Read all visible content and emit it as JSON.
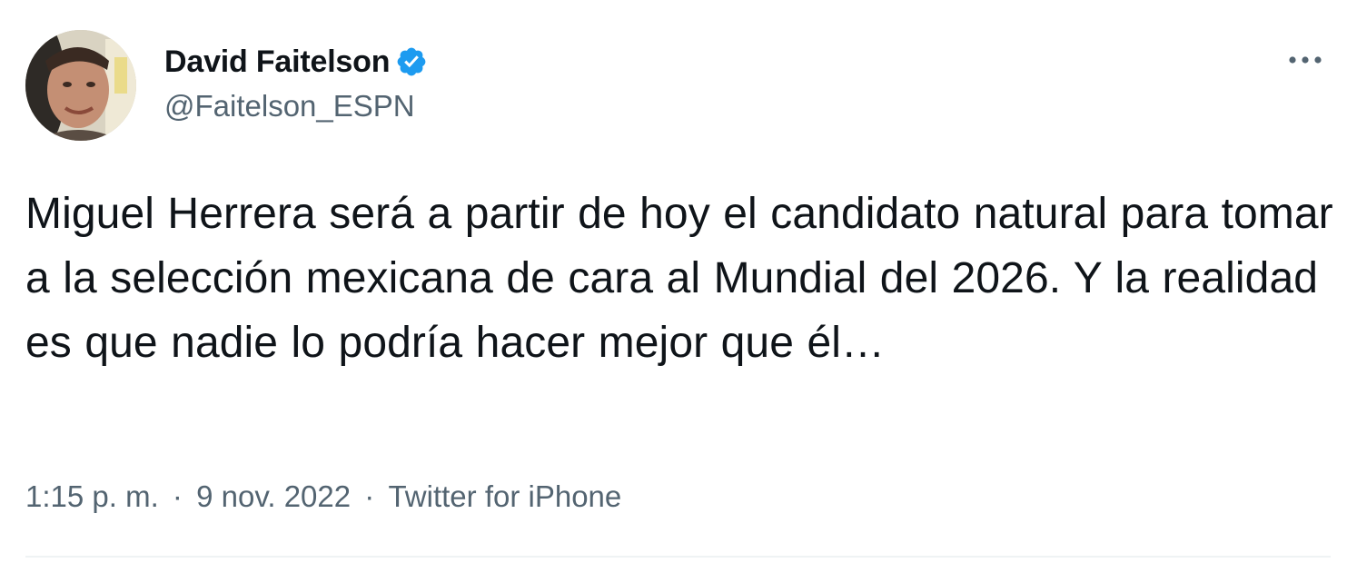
{
  "tweet": {
    "author": {
      "display_name": "David Faitelson",
      "handle": "@Faitelson_ESPN",
      "verified": true,
      "verified_icon": "verified-badge-icon",
      "avatar": "author-avatar"
    },
    "text": "Miguel Herrera será a partir de hoy el candidato natural para tomar a la selección mexicana de cara al Mundial del 2026. Y la realidad es que nadie lo podría hacer mejor que él…",
    "time": "1:15 p. m.",
    "separator": "·",
    "date": "9 nov. 2022",
    "source": "Twitter for iPhone",
    "more_icon": "more-options-icon"
  },
  "colors": {
    "text_primary": "#0f1419",
    "text_secondary": "#536471",
    "verified_blue": "#1d9bf0",
    "divider": "#eff3f4"
  }
}
